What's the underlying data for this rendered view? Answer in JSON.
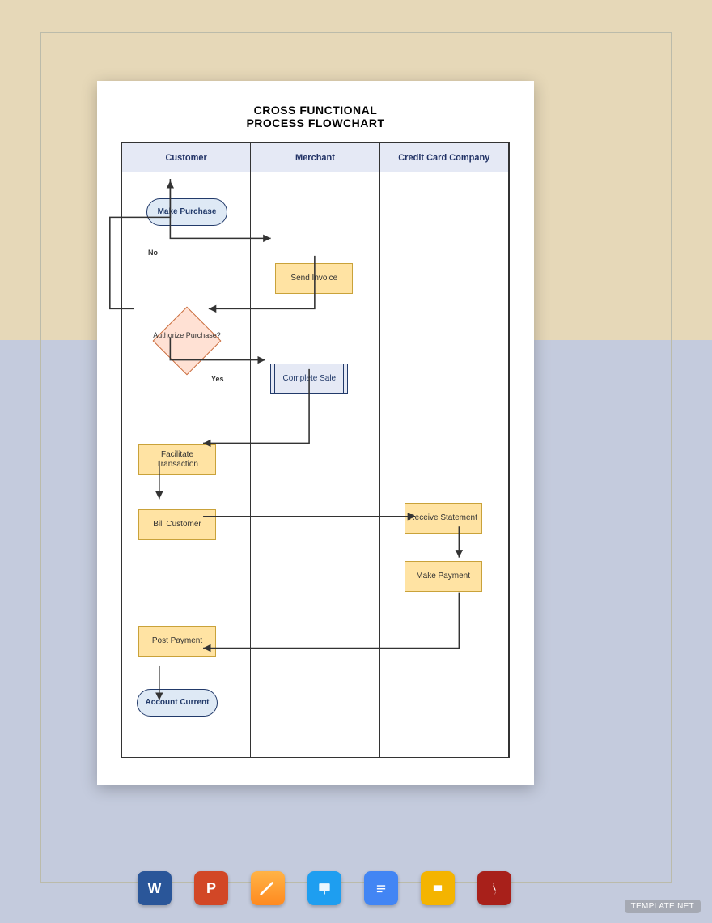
{
  "title": {
    "line1": "CROSS FUNCTIONAL",
    "line2": "PROCESS FLOWCHART"
  },
  "lanes": [
    "Customer",
    "Merchant",
    "Credit Card Company"
  ],
  "nodes": {
    "make_purchase": "Make Purchase",
    "send_invoice": "Send Invoice",
    "authorize": "Authorize Purchase?",
    "complete_sale": "Complete Sale",
    "facilitate": "Facilitate Transaction",
    "bill_customer": "Bill Customer",
    "receive_stmt": "Receive Statement",
    "make_payment": "Make Payment",
    "post_payment": "Post Payment",
    "account_current": "Account Current"
  },
  "labels": {
    "no": "No",
    "yes": "Yes"
  },
  "icons": [
    "word",
    "powerpoint",
    "pages",
    "keynote",
    "google-docs",
    "google-slides",
    "pdf"
  ],
  "watermark": "TEMPLATE.NET"
}
